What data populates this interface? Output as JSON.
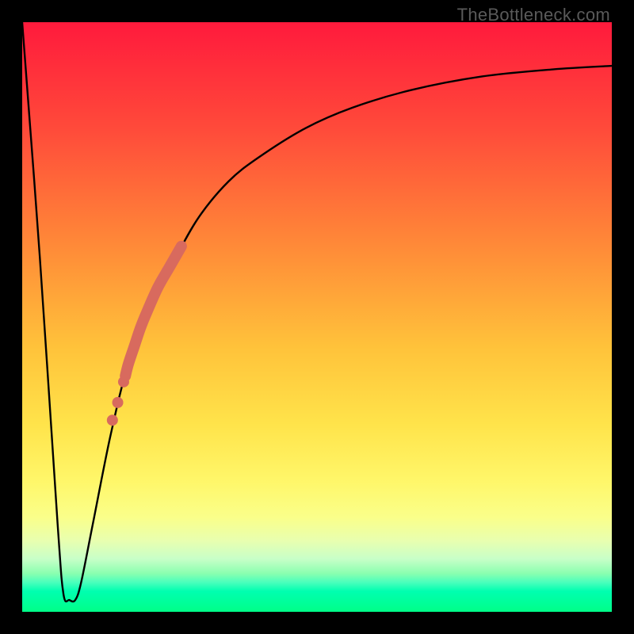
{
  "watermark": "TheBottleneck.com",
  "colors": {
    "frame": "#000000",
    "curve": "#000000",
    "highlight": "#d86a5e"
  },
  "chart_data": {
    "type": "line",
    "title": "",
    "xlabel": "",
    "ylabel": "",
    "xlim": [
      0,
      100
    ],
    "ylim": [
      0,
      100
    ],
    "grid": false,
    "legend": false,
    "annotations": [
      "TheBottleneck.com"
    ],
    "x": [
      0,
      3,
      6,
      7,
      8,
      9,
      10,
      12,
      15,
      18,
      22,
      26,
      30,
      35,
      40,
      48,
      56,
      66,
      78,
      90,
      100
    ],
    "y": [
      100,
      60,
      15,
      3,
      2,
      2,
      5,
      15,
      30,
      42,
      52,
      60,
      67,
      73,
      77,
      82,
      85.5,
      88.5,
      90.8,
      92,
      92.6
    ],
    "highlight_segment": {
      "x": [
        17.5,
        18,
        19,
        20,
        21,
        23,
        25,
        27
      ],
      "y": [
        40,
        42,
        45,
        48,
        50.5,
        55,
        58.5,
        62
      ]
    },
    "highlight_dots": [
      {
        "x": 17.2,
        "y": 39
      },
      {
        "x": 16.2,
        "y": 35.5
      },
      {
        "x": 15.3,
        "y": 32.5
      }
    ]
  }
}
